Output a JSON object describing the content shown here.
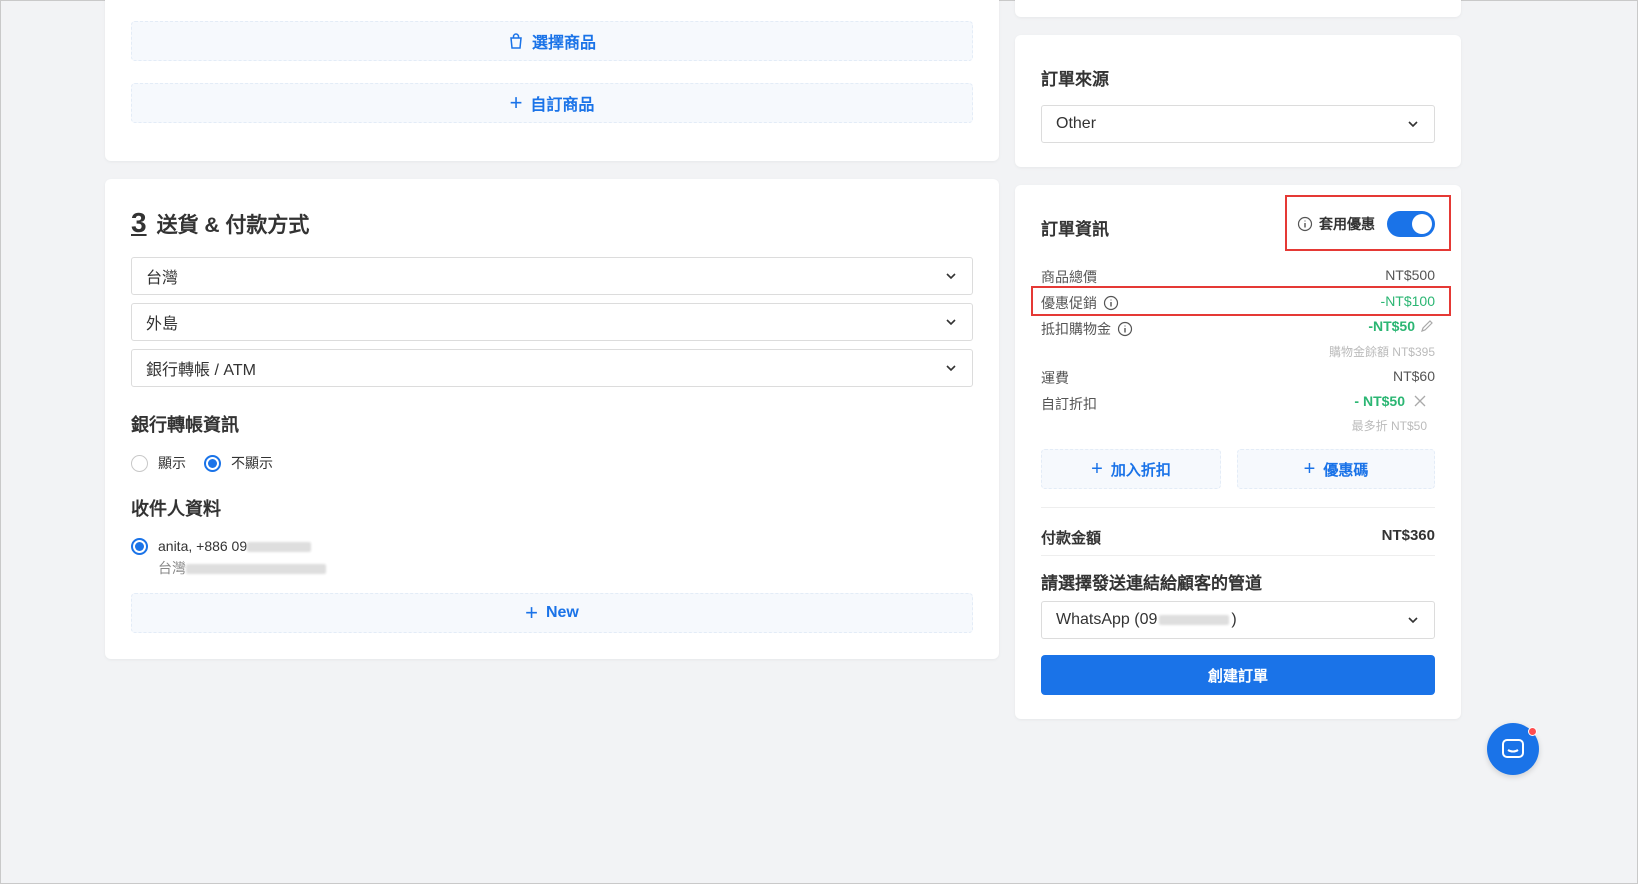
{
  "products": {
    "select_products": "選擇商品",
    "custom_product": "自訂商品"
  },
  "shipping": {
    "step_number": "3",
    "title": "送貨 & 付款方式",
    "country": "台灣",
    "region": "外島",
    "payment": "銀行轉帳 / ATM",
    "bank_info_label": "銀行轉帳資訊",
    "show_label": "顯示",
    "hide_label": "不顯示",
    "bank_info_selected": "不顯示",
    "recipient_label": "收件人資料",
    "recipient_name_phone": "anita, +886 09",
    "recipient_address": "台灣",
    "new_label": "New"
  },
  "order_source": {
    "title": "訂單來源",
    "value": "Other"
  },
  "order_info": {
    "title": "訂單資訊",
    "apply_discount_label": "套用優惠",
    "apply_discount_on": true,
    "rows": {
      "subtotal_label": "商品總價",
      "subtotal_value": "NT$500",
      "promo_label": "優惠促銷",
      "promo_value": "-NT$100",
      "credit_label": "抵扣購物金",
      "credit_value": "-NT$50",
      "credit_balance": "購物金餘額 NT$395",
      "shipping_label": "運費",
      "shipping_value": "NT$60",
      "custom_discount_label": "自訂折扣",
      "custom_discount_value": "- NT$50",
      "custom_discount_max": "最多折 NT$50"
    },
    "add_discount": "加入折扣",
    "coupon": "優惠碼",
    "total_label": "付款金額",
    "total_value": "NT$360",
    "channel_label": "請選擇發送連結給顧客的管道",
    "channel_value_prefix": "WhatsApp (09",
    "channel_value_suffix": ")",
    "create_button": "創建訂單"
  },
  "colors": {
    "accent": "#1a73e8",
    "green": "#2bb673",
    "highlight_red": "#e53935"
  }
}
